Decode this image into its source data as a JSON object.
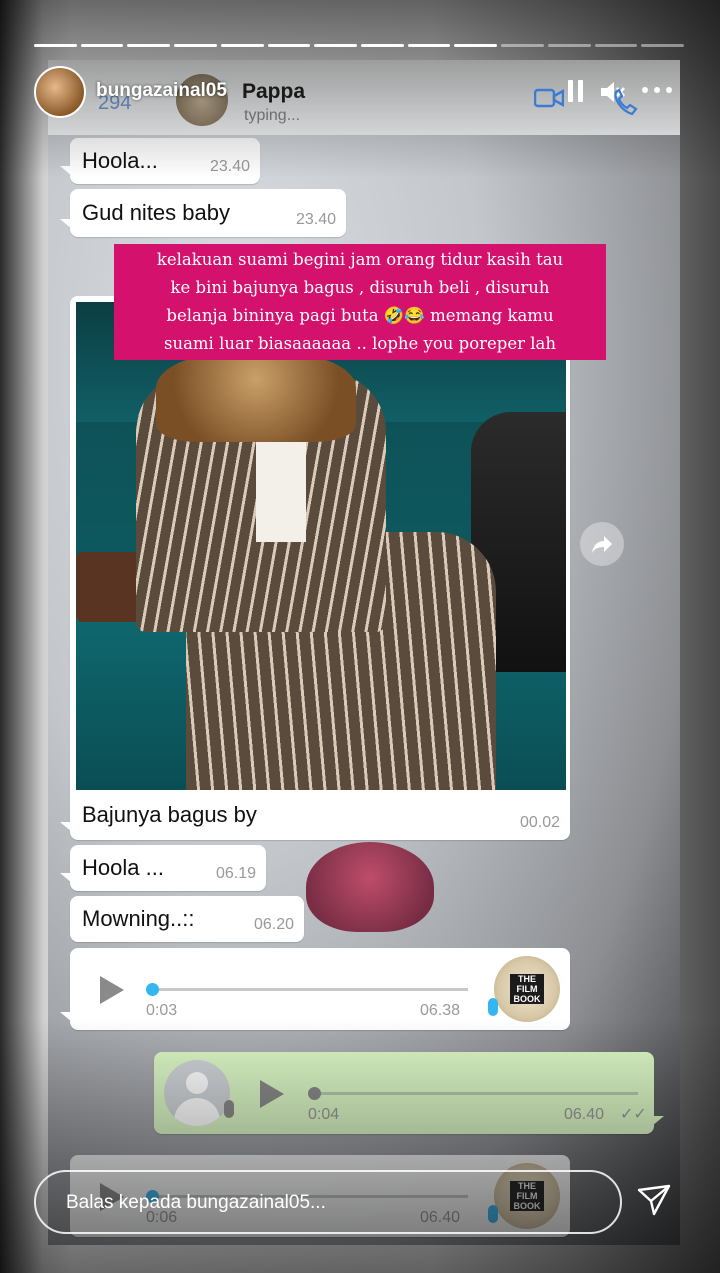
{
  "story": {
    "username": "bungazainal05",
    "progress": {
      "segments_total": 14,
      "segments_done": 10
    },
    "caption_lines": [
      "kelakuan suami begini jam orang tidur kasih tau",
      "ke bini bajunya bagus , disuruh beli , disuruh",
      "belanja bininya pagi buta 🤣😂 memang kamu",
      "suami luar biasaaaaaa .. lophe you poreper lah"
    ],
    "reply_placeholder": "Balas kepada bungazainal05...",
    "icons": {
      "pause": "pause-icon",
      "mute": "mute-icon",
      "more": "more-icon",
      "send": "send-icon"
    }
  },
  "whatsapp": {
    "back_count": "294",
    "contact_name": "Pappa",
    "status": "typing...",
    "icons": {
      "video": "video-call-icon",
      "phone": "phone-icon"
    }
  },
  "messages": [
    {
      "text": "Hoola...",
      "time": "23.40"
    },
    {
      "text": "Gud nites baby",
      "time": "23.40"
    },
    {
      "text": "Bajunya bagus by",
      "time": "00.02"
    },
    {
      "text": "Hoola ...",
      "time": "06.19"
    },
    {
      "text": "Mowning..::",
      "time": "06.20"
    }
  ],
  "voice_notes": [
    {
      "elapsed": "0:03",
      "time": "06.38",
      "direction": "incoming"
    },
    {
      "elapsed": "0:04",
      "time": "06.40",
      "direction": "outgoing"
    },
    {
      "elapsed": "0:06",
      "time": "06.40",
      "direction": "incoming"
    }
  ],
  "film_badge": {
    "line1": "THE",
    "line2": "FILM",
    "line3": "BOOK"
  },
  "colors": {
    "caption_bg": "#d4126e",
    "outgoing_bubble": "#dcf8c6",
    "accent_blue": "#34b7f1",
    "play_gray": "#8a8a8a"
  }
}
